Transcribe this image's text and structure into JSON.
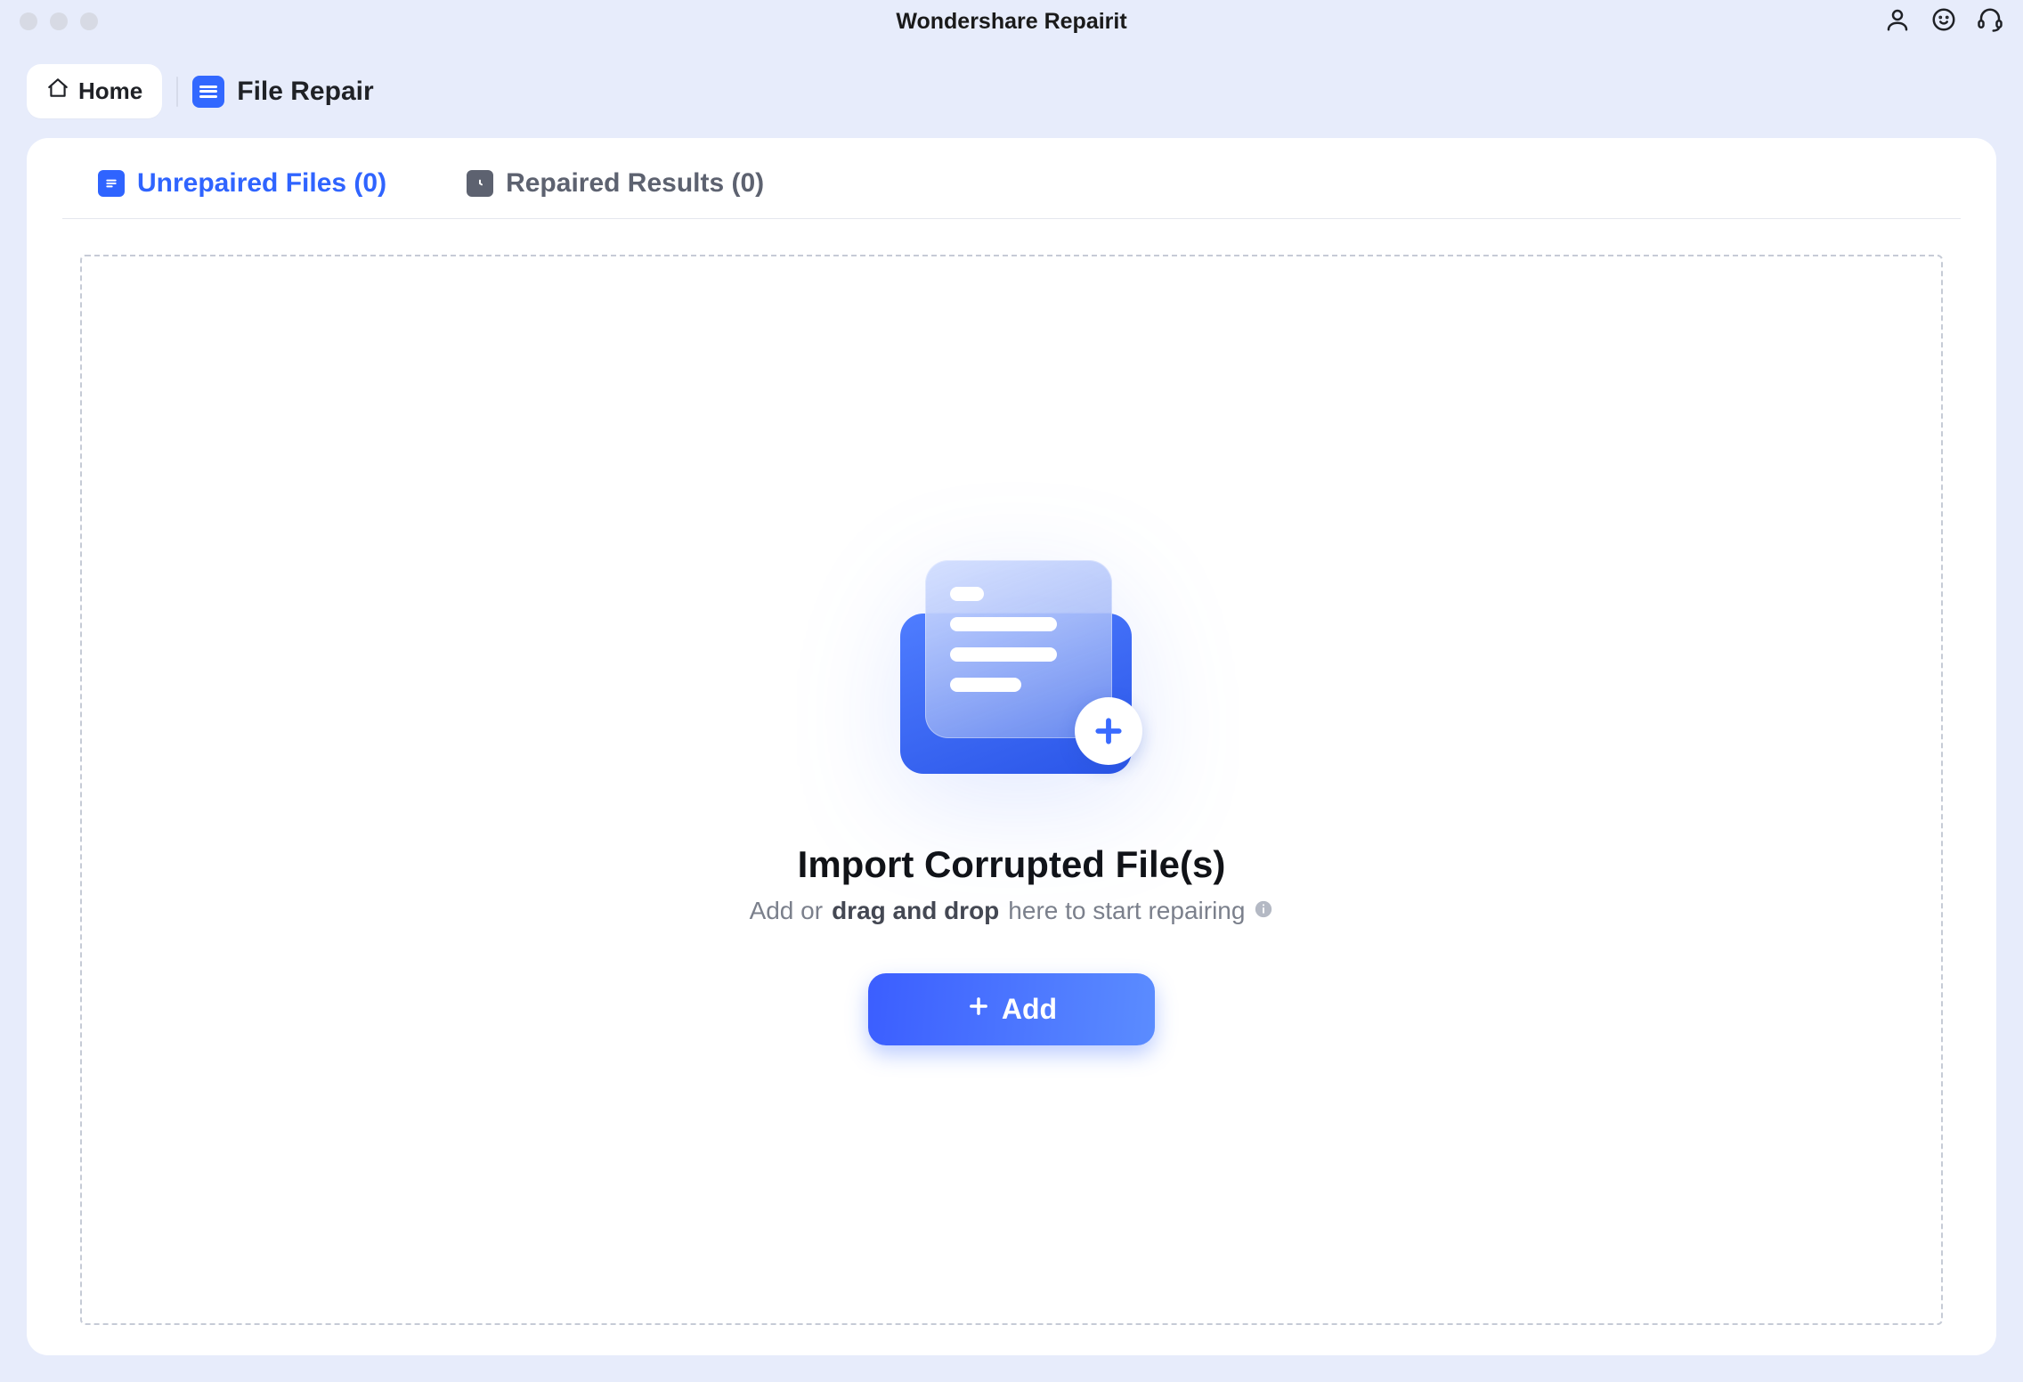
{
  "app": {
    "title": "Wondershare Repairit"
  },
  "toolbar": {
    "home_label": "Home",
    "breadcrumb_label": "File Repair"
  },
  "tabs": {
    "unrepaired": {
      "label": "Unrepaired Files (0)"
    },
    "repaired": {
      "label": "Repaired Results (0)"
    }
  },
  "dropzone": {
    "title": "Import Corrupted File(s)",
    "sub_prefix": "Add or ",
    "sub_strong": "drag and drop",
    "sub_suffix": " here to start repairing",
    "add_label": "Add"
  }
}
